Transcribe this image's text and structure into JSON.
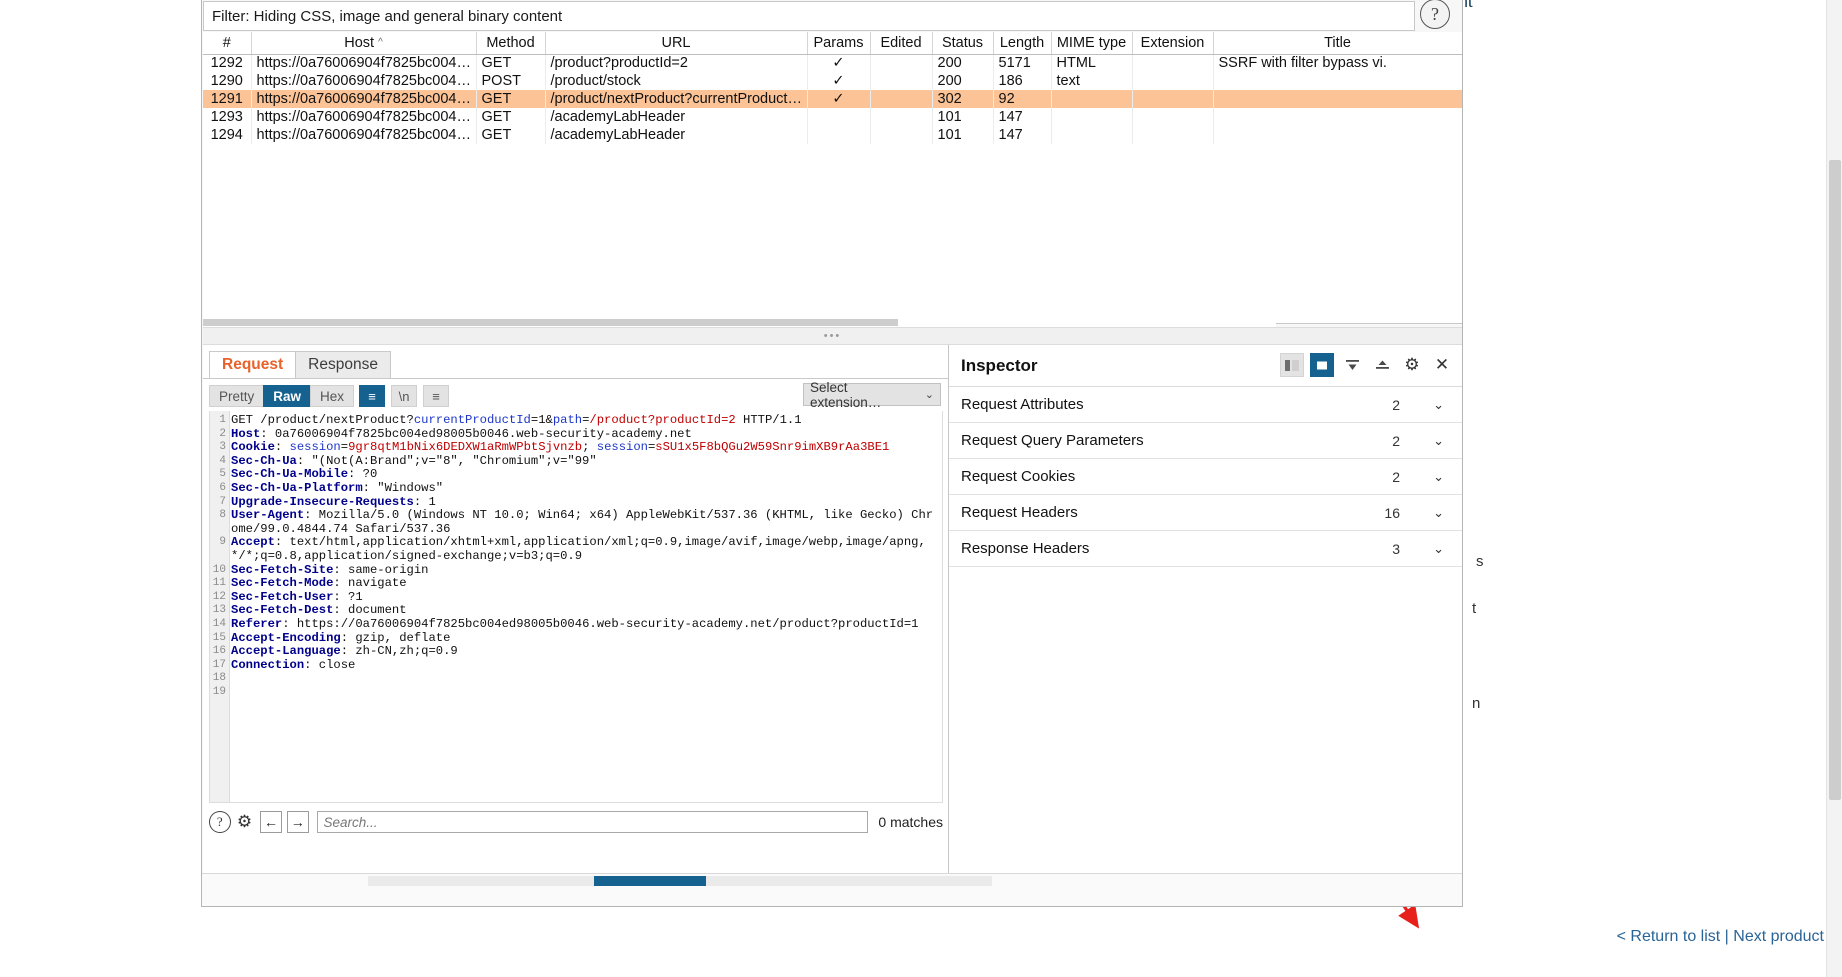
{
  "lab_page": {
    "top_right_text": "unt",
    "right_snippets": [
      "s",
      "t",
      "n"
    ],
    "footer": {
      "return_link": "< Return to list",
      "separator": "|",
      "next_link": "Next product"
    }
  },
  "burp": {
    "filter": {
      "text": "Filter: Hiding CSS, image and general binary content",
      "help_icon": "question-mark-icon"
    },
    "history_table": {
      "columns": [
        "#",
        "Host",
        "Method",
        "URL",
        "Params",
        "Edited",
        "Status",
        "Length",
        "MIME type",
        "Extension",
        "Title"
      ],
      "sorted_column": "Host",
      "sort_caret": "^",
      "rows": [
        {
          "num": "1292",
          "host": "https://0a76006904f7825bc004…",
          "method": "GET",
          "url": "/product?productId=2",
          "params": "✓",
          "edited": "",
          "status": "200",
          "length": "5171",
          "mime": "HTML",
          "extension": "",
          "title": "SSRF with filter bypass vi.",
          "selected": false
        },
        {
          "num": "1290",
          "host": "https://0a76006904f7825bc004…",
          "method": "POST",
          "url": "/product/stock",
          "params": "✓",
          "edited": "",
          "status": "200",
          "length": "186",
          "mime": "text",
          "extension": "",
          "title": "",
          "selected": false
        },
        {
          "num": "1291",
          "host": "https://0a76006904f7825bc004…",
          "method": "GET",
          "url": "/product/nextProduct?currentProduct…",
          "params": "✓",
          "edited": "",
          "status": "302",
          "length": "92",
          "mime": "",
          "extension": "",
          "title": "",
          "selected": true
        },
        {
          "num": "1293",
          "host": "https://0a76006904f7825bc004…",
          "method": "GET",
          "url": "/academyLabHeader",
          "params": "",
          "edited": "",
          "status": "101",
          "length": "147",
          "mime": "",
          "extension": "",
          "title": "",
          "selected": false
        },
        {
          "num": "1294",
          "host": "https://0a76006904f7825bc004…",
          "method": "GET",
          "url": "/academyLabHeader",
          "params": "",
          "edited": "",
          "status": "101",
          "length": "147",
          "mime": "",
          "extension": "",
          "title": "",
          "selected": false
        }
      ]
    },
    "editor": {
      "tabs": [
        {
          "label": "Request",
          "active": true
        },
        {
          "label": "Response",
          "active": false
        }
      ],
      "view_modes": [
        {
          "label": "Pretty",
          "active": false
        },
        {
          "label": "Raw",
          "active": true
        },
        {
          "label": "Hex",
          "active": false
        }
      ],
      "icon_buttons": [
        {
          "name": "word-wrap-icon",
          "glyph": "≡",
          "active": true
        },
        {
          "name": "show-newlines-icon",
          "glyph": "\\n",
          "active": false
        },
        {
          "name": "more-options-icon",
          "glyph": "≡",
          "active": false
        }
      ],
      "extension_select": {
        "value": "Select extension…",
        "chevron": "⌄"
      },
      "line_numbers": [
        "1",
        "2",
        "3",
        "4",
        "5",
        "6",
        "7",
        "8",
        "",
        "9",
        "",
        "",
        "10",
        "11",
        "12",
        "13",
        "14",
        "15",
        "16",
        "17",
        "18",
        "19"
      ],
      "request_lines": [
        {
          "n": 1,
          "segments": [
            {
              "t": "GET /product/nextProduct?",
              "c": "pl"
            },
            {
              "t": "currentProductId",
              "c": "b"
            },
            {
              "t": "=1&",
              "c": "pl"
            },
            {
              "t": "path",
              "c": "b"
            },
            {
              "t": "=",
              "c": "pl"
            },
            {
              "t": "/product?productId=2",
              "c": "rd"
            },
            {
              "t": " HTTP/1.1",
              "c": "pl"
            }
          ]
        },
        {
          "n": 2,
          "segments": [
            {
              "t": "Host",
              "c": "k"
            },
            {
              "t": ": 0a76006904f7825bc004ed98005b0046.web-security-academy.net",
              "c": "pl"
            }
          ]
        },
        {
          "n": 3,
          "segments": [
            {
              "t": "Cookie",
              "c": "k"
            },
            {
              "t": ": ",
              "c": "pl"
            },
            {
              "t": "session",
              "c": "b"
            },
            {
              "t": "=",
              "c": "pl"
            },
            {
              "t": "9gr8qtM1bNix6DEDXW1aRmWPbtSjvnzb",
              "c": "rd"
            },
            {
              "t": "; ",
              "c": "pl"
            },
            {
              "t": "session",
              "c": "b"
            },
            {
              "t": "=",
              "c": "pl"
            },
            {
              "t": "sSU1x5F8bQGu2W59Snr9imXB9rAa3BE1",
              "c": "rd"
            }
          ]
        },
        {
          "n": 4,
          "segments": [
            {
              "t": "Sec-Ch-Ua",
              "c": "k"
            },
            {
              "t": ": \"(Not(A:Brand\";v=\"8\", \"Chromium\";v=\"99\"",
              "c": "pl"
            }
          ]
        },
        {
          "n": 5,
          "segments": [
            {
              "t": "Sec-Ch-Ua-Mobile",
              "c": "k"
            },
            {
              "t": ": ?0",
              "c": "pl"
            }
          ]
        },
        {
          "n": 6,
          "segments": [
            {
              "t": "Sec-Ch-Ua-Platform",
              "c": "k"
            },
            {
              "t": ": \"Windows\"",
              "c": "pl"
            }
          ]
        },
        {
          "n": 7,
          "segments": [
            {
              "t": "Upgrade-Insecure-Requests",
              "c": "k"
            },
            {
              "t": ": 1",
              "c": "pl"
            }
          ]
        },
        {
          "n": 8,
          "segments": [
            {
              "t": "User-Agent",
              "c": "k"
            },
            {
              "t": ": Mozilla/5.0 (Windows NT 10.0; Win64; x64) AppleWebKit/537.36 (KHTML, like Gecko) Chrome/99.0.4844.74 Safari/537.36",
              "c": "pl"
            }
          ]
        },
        {
          "n": 9,
          "segments": [
            {
              "t": "Accept",
              "c": "k"
            },
            {
              "t": ": text/html,application/xhtml+xml,application/xml;q=0.9,image/avif,image/webp,image/apng,*/*;q=0.8,application/signed-exchange;v=b3;q=0.9",
              "c": "pl"
            }
          ]
        },
        {
          "n": 10,
          "segments": [
            {
              "t": "Sec-Fetch-Site",
              "c": "k"
            },
            {
              "t": ": same-origin",
              "c": "pl"
            }
          ]
        },
        {
          "n": 11,
          "segments": [
            {
              "t": "Sec-Fetch-Mode",
              "c": "k"
            },
            {
              "t": ": navigate",
              "c": "pl"
            }
          ]
        },
        {
          "n": 12,
          "segments": [
            {
              "t": "Sec-Fetch-User",
              "c": "k"
            },
            {
              "t": ": ?1",
              "c": "pl"
            }
          ]
        },
        {
          "n": 13,
          "segments": [
            {
              "t": "Sec-Fetch-Dest",
              "c": "k"
            },
            {
              "t": ": document",
              "c": "pl"
            }
          ]
        },
        {
          "n": 14,
          "segments": [
            {
              "t": "Referer",
              "c": "k"
            },
            {
              "t": ": https://0a76006904f7825bc004ed98005b0046.web-security-academy.net/product?productId=1",
              "c": "pl"
            }
          ]
        },
        {
          "n": 15,
          "segments": [
            {
              "t": "Accept-Encoding",
              "c": "k"
            },
            {
              "t": ": gzip, deflate",
              "c": "pl"
            }
          ]
        },
        {
          "n": 16,
          "segments": [
            {
              "t": "Accept-Language",
              "c": "k"
            },
            {
              "t": ": zh-CN,zh;q=0.9",
              "c": "pl"
            }
          ]
        },
        {
          "n": 17,
          "segments": [
            {
              "t": "Connection",
              "c": "k"
            },
            {
              "t": ": close",
              "c": "pl"
            }
          ]
        },
        {
          "n": 18,
          "segments": []
        },
        {
          "n": 19,
          "segments": []
        }
      ],
      "bottom_bar": {
        "help_icon": "?",
        "gear_icon": "⚙",
        "prev_icon": "←",
        "next_icon": "→",
        "search_placeholder": "Search...",
        "search_value": "",
        "matches_text": "0 matches"
      }
    },
    "inspector": {
      "title": "Inspector",
      "toolbar_icons": [
        "split-view-icon",
        "panel-right-icon",
        "collapse-all-icon",
        "expand-all-icon",
        "settings-gear-icon",
        "close-icon"
      ],
      "sections": [
        {
          "label": "Request Attributes",
          "count": "2",
          "chevron": "⌄"
        },
        {
          "label": "Request Query Parameters",
          "count": "2",
          "chevron": "⌄"
        },
        {
          "label": "Request Cookies",
          "count": "2",
          "chevron": "⌄"
        },
        {
          "label": "Request Headers",
          "count": "16",
          "chevron": "⌄"
        },
        {
          "label": "Response Headers",
          "count": "3",
          "chevron": "⌄"
        }
      ]
    }
  },
  "colors": {
    "burp_orange": "#e8622b",
    "selected_row": "#fbc396",
    "accent_blue": "#15618f",
    "annotation_red": "#e8201b",
    "link_blue": "#2a6496"
  }
}
